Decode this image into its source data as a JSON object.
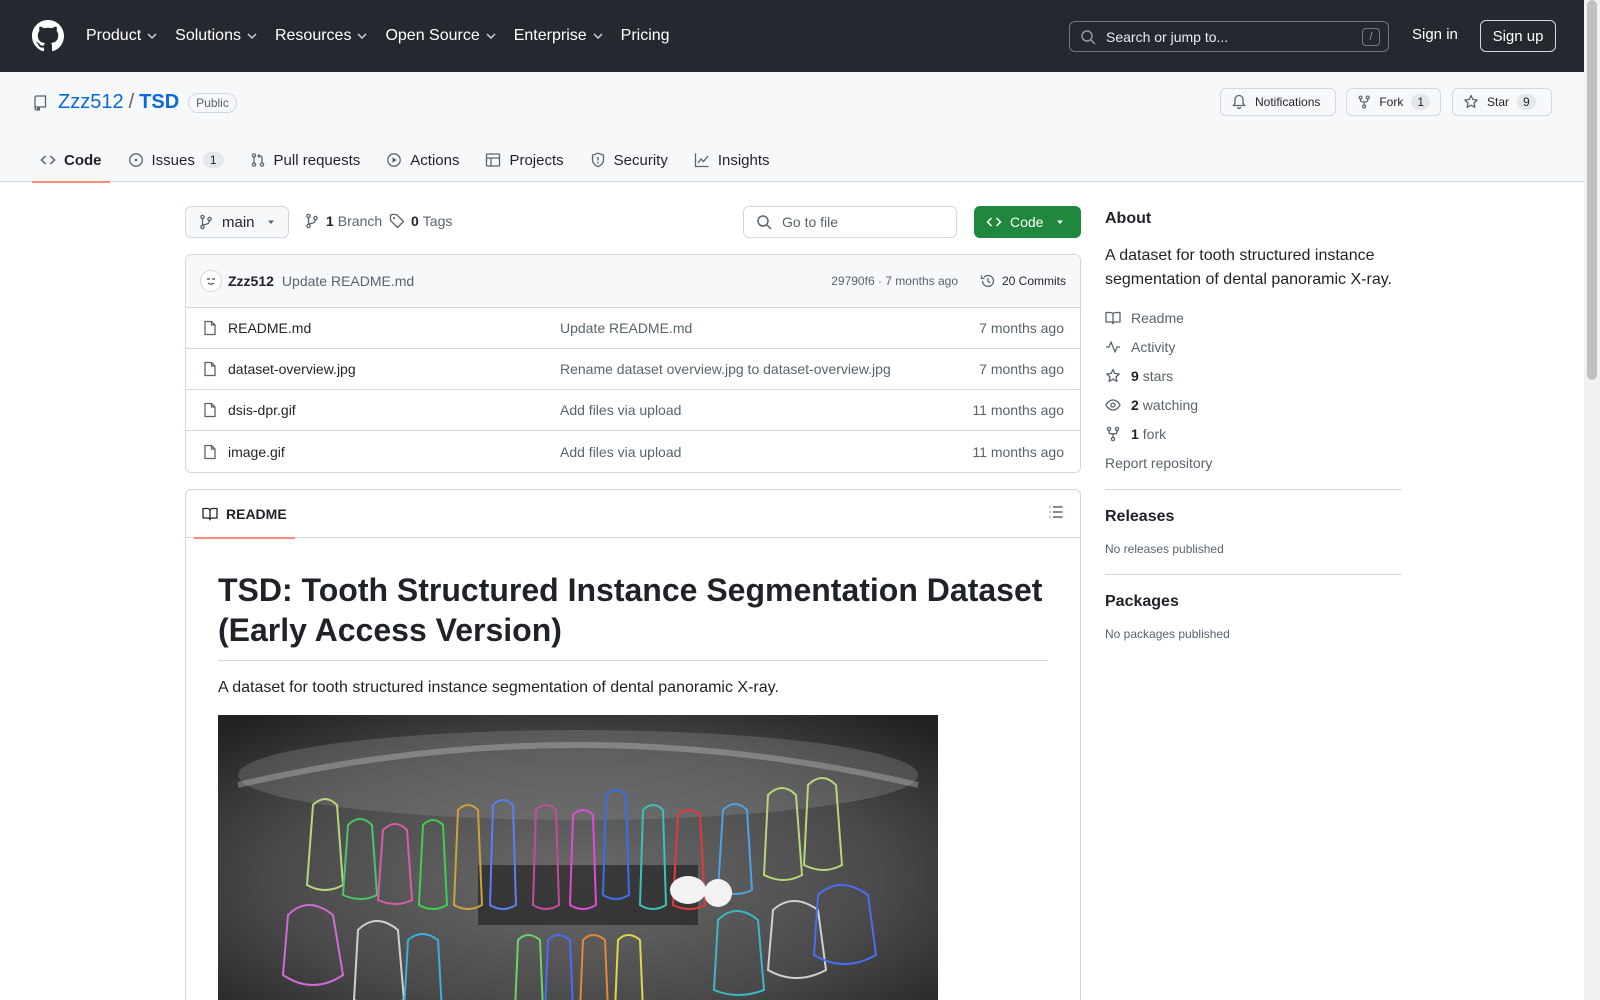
{
  "header": {
    "nav": [
      "Product",
      "Solutions",
      "Resources",
      "Open Source",
      "Enterprise",
      "Pricing"
    ],
    "search_placeholder": "Search or jump to...",
    "search_shortcut": "/",
    "sign_in": "Sign in",
    "sign_up": "Sign up"
  },
  "repo": {
    "owner": "Zzz512",
    "separator": "/",
    "name": "TSD",
    "visibility": "Public",
    "notifications_label": "Notifications",
    "fork_label": "Fork",
    "fork_count": "1",
    "star_label": "Star",
    "star_count": "9"
  },
  "tabs": [
    {
      "label": "Code",
      "count": ""
    },
    {
      "label": "Issues",
      "count": "1"
    },
    {
      "label": "Pull requests",
      "count": ""
    },
    {
      "label": "Actions",
      "count": ""
    },
    {
      "label": "Projects",
      "count": ""
    },
    {
      "label": "Security",
      "count": ""
    },
    {
      "label": "Insights",
      "count": ""
    }
  ],
  "toolbar": {
    "branch": "main",
    "branch_count": "1",
    "branch_label": "Branch",
    "tag_count": "0",
    "tag_label": "Tags",
    "goto_placeholder": "Go to file",
    "code_label": "Code"
  },
  "commit": {
    "author": "Zzz512",
    "message": "Update README.md",
    "meta": "29790f6 · 7 months ago",
    "count_label": "20 Commits"
  },
  "files": [
    {
      "name": "README.md",
      "message": "Update README.md",
      "date": "7 months ago"
    },
    {
      "name": "dataset-overview.jpg",
      "message": "Rename dataset overview.jpg to dataset-overview.jpg",
      "date": "7 months ago"
    },
    {
      "name": "dsis-dpr.gif",
      "message": "Add files via upload",
      "date": "11 months ago"
    },
    {
      "name": "image.gif",
      "message": "Add files via upload",
      "date": "11 months ago"
    }
  ],
  "readme": {
    "tab_label": "README",
    "title": "TSD: Tooth Structured Instance Segmentation Dataset (Early Access Version)",
    "description": "A dataset for tooth structured instance segmentation of dental panoramic X-ray."
  },
  "about": {
    "heading": "About",
    "description": "A dataset for tooth structured instance segmentation of dental panoramic X-ray.",
    "readme": "Readme",
    "activity": "Activity",
    "stars_count": "9",
    "stars_label": "stars",
    "watching_count": "2",
    "watching_label": "watching",
    "fork_count": "1",
    "fork_label": "fork",
    "report": "Report repository"
  },
  "releases": {
    "heading": "Releases",
    "empty": "No releases published"
  },
  "packages": {
    "heading": "Packages",
    "empty": "No packages published"
  },
  "colors": {
    "header_bg": "#24292f",
    "accent": "#0969da",
    "primary_button": "#1f883d",
    "tab_underline": "#fd8c73"
  }
}
